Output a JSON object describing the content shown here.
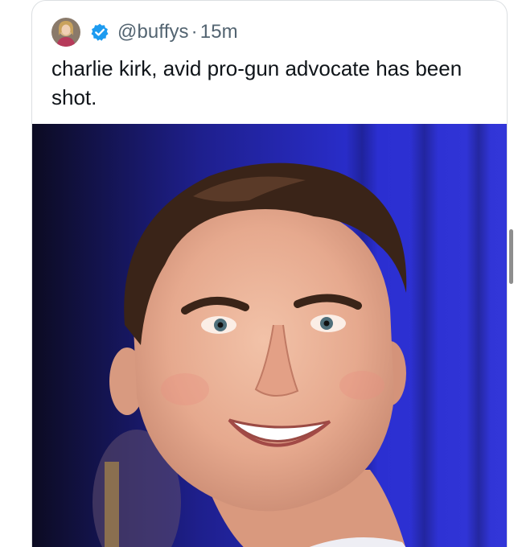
{
  "tweet": {
    "avatar_icon": "profile-avatar",
    "verified_icon": "verified-badge-icon",
    "verified_color": "#1d9bf0",
    "handle": "@buffys",
    "separator": "·",
    "time": "15m",
    "text": "charlie kirk, avid pro-gun advocate has been shot.",
    "media": {
      "description_icon": "portrait-photo"
    }
  },
  "colors": {
    "text_primary": "#0f1419",
    "text_secondary": "#536471",
    "border": "#dcdfe2",
    "photo_background": "#2a2dcf"
  }
}
